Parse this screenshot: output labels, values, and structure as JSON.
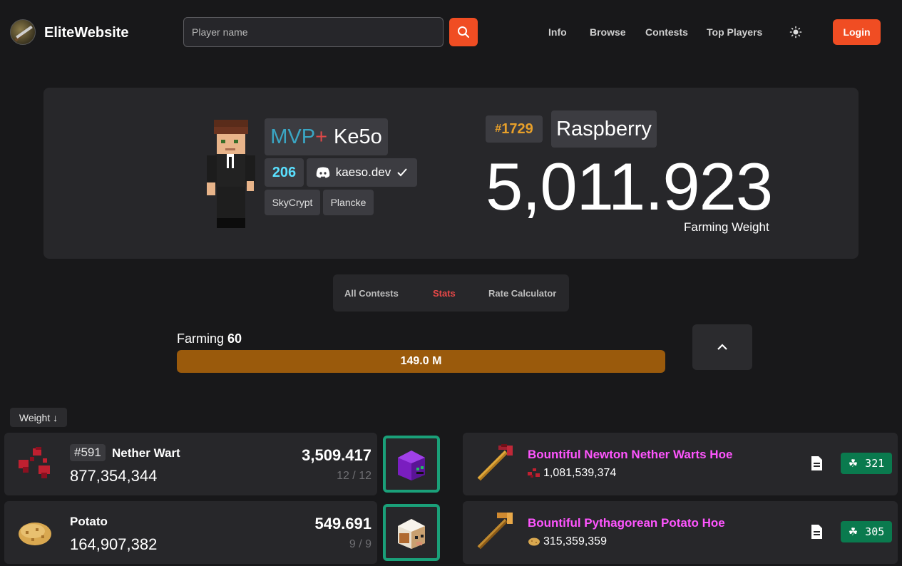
{
  "nav": {
    "brand": "EliteWebsite",
    "search_placeholder": "Player name",
    "links": [
      "Info",
      "Browse",
      "Contests",
      "Top Players"
    ],
    "login": "Login",
    "accent": "#f04d23"
  },
  "profile": {
    "rank_prefix": "MVP",
    "rank_plus": "+",
    "username": "Ke5o",
    "level": "206",
    "discord": "kaeso.dev",
    "links": [
      "SkyCrypt",
      "Plancke"
    ],
    "leaderboard_rank": "1729",
    "profile_name": "Raspberry",
    "farming_weight": "5,011.923",
    "farming_weight_label": "Farming Weight"
  },
  "tabs": [
    "All Contests",
    "Stats",
    "Rate Calculator"
  ],
  "active_tab": "Stats",
  "skill": {
    "label": "Farming",
    "level": "60",
    "xp_text": "149.0 M",
    "progress_fraction": 1.0,
    "bar_color": "#9a5a0c"
  },
  "sort": {
    "label": "Weight ↓"
  },
  "crops": [
    {
      "rank": "#591",
      "name": "Nether Wart",
      "collection": "877,354,344",
      "weight": "3,509.417",
      "progress": "12 / 12",
      "pet_icon": "purple-rabbit-head-icon"
    },
    {
      "rank": "",
      "name": "Potato",
      "collection": "164,907,382",
      "weight": "549.691",
      "progress": "9 / 9",
      "pet_icon": "mooshroom-head-icon"
    }
  ],
  "tools": [
    {
      "name": "Bountiful Newton Nether Warts Hoe",
      "count": "1,081,539,374",
      "fortune": "321",
      "icon": "nether-wart-hoe-icon"
    },
    {
      "name": "Bountiful Pythagorean Potato Hoe",
      "count": "315,359,359",
      "fortune": "305",
      "icon": "potato-hoe-icon"
    }
  ]
}
